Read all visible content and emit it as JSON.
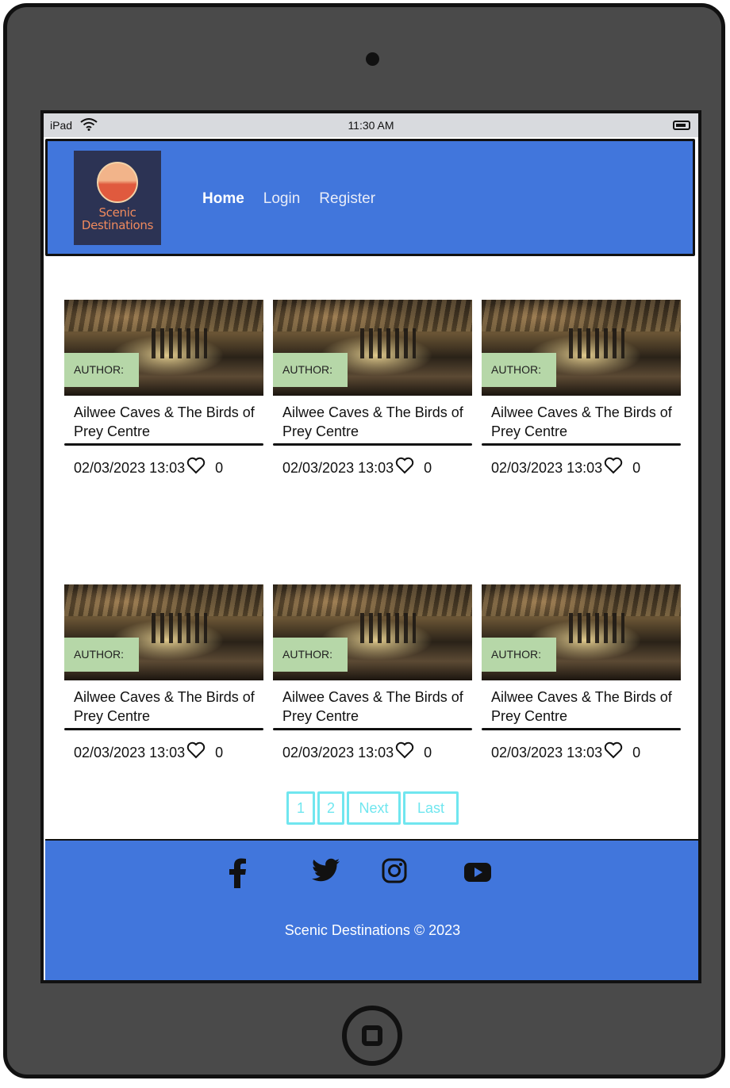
{
  "status_bar": {
    "carrier": "iPad",
    "time": "11:30 AM"
  },
  "header": {
    "logo_text_line1": "Scenic",
    "logo_text_line2": "Destinations",
    "nav": [
      {
        "label": "Home",
        "active": true
      },
      {
        "label": "Login",
        "active": false
      },
      {
        "label": "Register",
        "active": false
      }
    ]
  },
  "posts": [
    {
      "author_label": "AUTHOR:",
      "title": "Ailwee Caves & The Birds of Prey Centre",
      "date": "02/03/2023 13:03",
      "likes": "0"
    },
    {
      "author_label": "AUTHOR:",
      "title": "Ailwee Caves & The Birds of Prey Centre",
      "date": "02/03/2023 13:03",
      "likes": "0"
    },
    {
      "author_label": "AUTHOR:",
      "title": "Ailwee Caves & The Birds of Prey Centre",
      "date": "02/03/2023 13:03",
      "likes": "0"
    },
    {
      "author_label": "AUTHOR:",
      "title": "Ailwee Caves & The Birds of Prey Centre",
      "date": "02/03/2023 13:03",
      "likes": "0"
    },
    {
      "author_label": "AUTHOR:",
      "title": "Ailwee Caves & The Birds of Prey Centre",
      "date": "02/03/2023 13:03",
      "likes": "0"
    },
    {
      "author_label": "AUTHOR:",
      "title": "Ailwee Caves & The Birds of Prey Centre",
      "date": "02/03/2023 13:03",
      "likes": "0"
    }
  ],
  "pagination": {
    "page1": "1",
    "page2": "2",
    "next": "Next",
    "last": "Last"
  },
  "footer": {
    "social_icons": [
      "facebook-icon",
      "twitter-icon",
      "instagram-icon",
      "youtube-icon"
    ],
    "copyright": "Scenic Destinations © 2023"
  },
  "colors": {
    "nav_bg": "#4176dc",
    "author_badge": "#b6d7a8",
    "pagination_accent": "#70e6ef"
  }
}
